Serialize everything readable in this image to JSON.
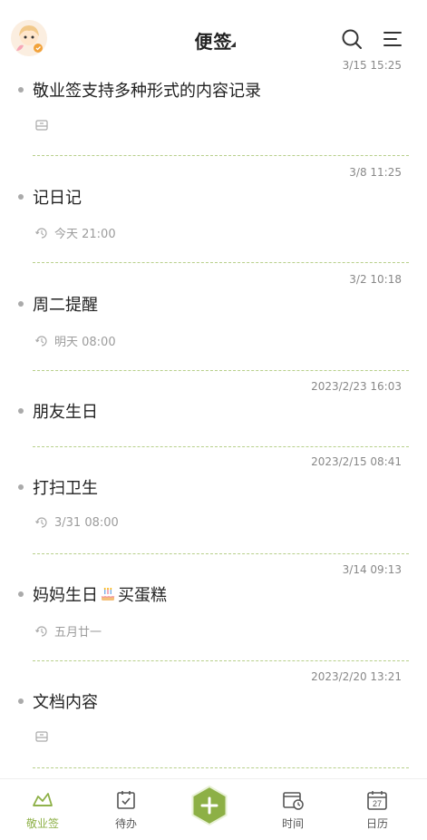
{
  "header": {
    "title": "便签",
    "icons": [
      "avatar",
      "search-icon",
      "menu-icon"
    ]
  },
  "notes": [
    {
      "time": "3/15 15:25",
      "title": "敬业签支持多种形式的内容记录",
      "sub_icon": "attachment-icon",
      "sub": ""
    },
    {
      "time": "3/8 11:25",
      "title": "记日记",
      "sub_icon": "repeat-reminder-icon",
      "sub": "今天 21:00"
    },
    {
      "time": "3/2 10:18",
      "title": "周二提醒",
      "sub_icon": "repeat-reminder-icon",
      "sub": "明天 08:00"
    },
    {
      "time": "2023/2/23 16:03",
      "title": "朋友生日",
      "sub_icon": "",
      "sub": ""
    },
    {
      "time": "2023/2/15 08:41",
      "title": "打扫卫生",
      "sub_icon": "repeat-reminder-icon",
      "sub": "3/31 08:00"
    },
    {
      "time": "3/14 09:13",
      "title_a": "妈妈生日",
      "title_b": "买蛋糕",
      "sub_icon": "repeat-reminder-icon",
      "sub": "五月廿一"
    },
    {
      "time": "2023/2/20 13:21",
      "title": "文档内容",
      "sub_icon": "attachment-icon",
      "sub": ""
    }
  ],
  "tabbar": {
    "items": [
      {
        "label": "敬业签",
        "icon": "note-icon",
        "active": true
      },
      {
        "label": "待办",
        "icon": "todo-icon"
      },
      {
        "label": "时间",
        "icon": "time-icon"
      },
      {
        "label": "日历",
        "icon": "calendar-icon"
      }
    ],
    "calendar_day": "27"
  },
  "colors": {
    "accent": "#8db046",
    "divider": "#b7cf8a",
    "fab": "#8db046"
  }
}
